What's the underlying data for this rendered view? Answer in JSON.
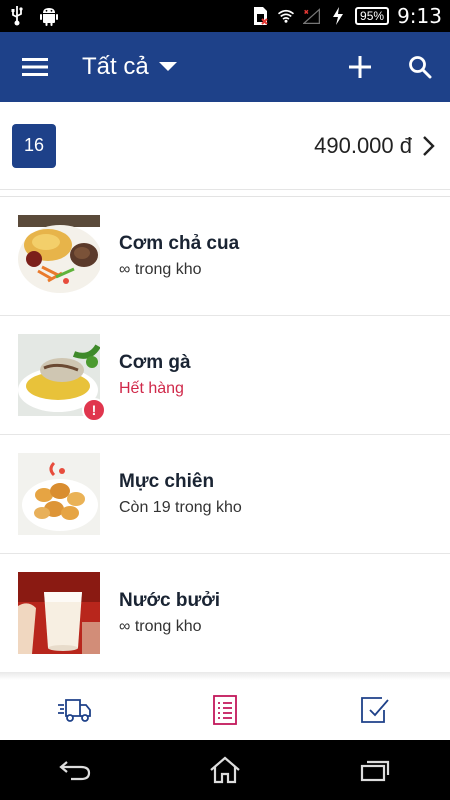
{
  "status_bar": {
    "icons_left": [
      "usb-icon",
      "android-icon"
    ],
    "icons_right": [
      "sim-icon",
      "wifi-icon",
      "signal-icon",
      "charging-icon"
    ],
    "battery": "95%",
    "time": "9:13"
  },
  "toolbar": {
    "title": "Tất cả",
    "icons": [
      "menu-icon",
      "dropdown-arrow-icon",
      "add-icon",
      "search-icon"
    ],
    "color": "#1e4189"
  },
  "summary": {
    "count": "16",
    "total": "490.000 đ"
  },
  "items": [
    {
      "name": "Cơm chả cua",
      "stock": "∞ trong kho",
      "out_of_stock": false
    },
    {
      "name": "Cơm gà",
      "stock": "Hết hàng",
      "out_of_stock": true,
      "badge": "!"
    },
    {
      "name": "Mực chiên",
      "stock": "Còn 19 trong kho",
      "out_of_stock": false
    },
    {
      "name": "Nước bưởi",
      "stock": "∞ trong kho",
      "out_of_stock": false
    }
  ],
  "bottom_bar": {
    "icons": [
      "delivery-truck-icon",
      "order-list-icon",
      "checkbox-icon"
    ],
    "active": "order-list-icon",
    "active_color": "#c2185b",
    "inactive_color": "#1e4189"
  },
  "nav_bar": {
    "icons": [
      "back-icon",
      "home-icon",
      "recents-icon"
    ]
  }
}
